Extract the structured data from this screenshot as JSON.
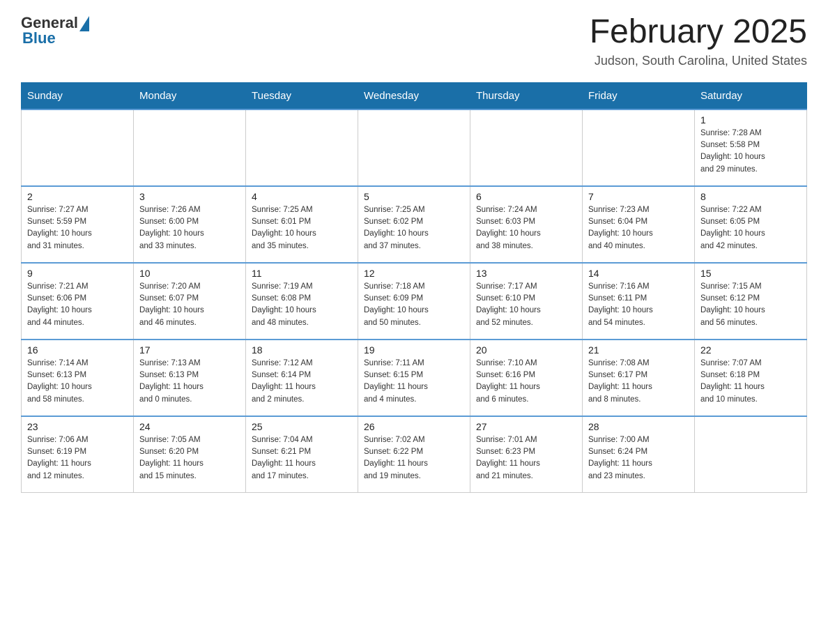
{
  "header": {
    "logo_general": "General",
    "logo_blue": "Blue",
    "title": "February 2025",
    "location": "Judson, South Carolina, United States"
  },
  "days_of_week": [
    "Sunday",
    "Monday",
    "Tuesday",
    "Wednesday",
    "Thursday",
    "Friday",
    "Saturday"
  ],
  "weeks": [
    [
      {
        "day": "",
        "info": ""
      },
      {
        "day": "",
        "info": ""
      },
      {
        "day": "",
        "info": ""
      },
      {
        "day": "",
        "info": ""
      },
      {
        "day": "",
        "info": ""
      },
      {
        "day": "",
        "info": ""
      },
      {
        "day": "1",
        "info": "Sunrise: 7:28 AM\nSunset: 5:58 PM\nDaylight: 10 hours\nand 29 minutes."
      }
    ],
    [
      {
        "day": "2",
        "info": "Sunrise: 7:27 AM\nSunset: 5:59 PM\nDaylight: 10 hours\nand 31 minutes."
      },
      {
        "day": "3",
        "info": "Sunrise: 7:26 AM\nSunset: 6:00 PM\nDaylight: 10 hours\nand 33 minutes."
      },
      {
        "day": "4",
        "info": "Sunrise: 7:25 AM\nSunset: 6:01 PM\nDaylight: 10 hours\nand 35 minutes."
      },
      {
        "day": "5",
        "info": "Sunrise: 7:25 AM\nSunset: 6:02 PM\nDaylight: 10 hours\nand 37 minutes."
      },
      {
        "day": "6",
        "info": "Sunrise: 7:24 AM\nSunset: 6:03 PM\nDaylight: 10 hours\nand 38 minutes."
      },
      {
        "day": "7",
        "info": "Sunrise: 7:23 AM\nSunset: 6:04 PM\nDaylight: 10 hours\nand 40 minutes."
      },
      {
        "day": "8",
        "info": "Sunrise: 7:22 AM\nSunset: 6:05 PM\nDaylight: 10 hours\nand 42 minutes."
      }
    ],
    [
      {
        "day": "9",
        "info": "Sunrise: 7:21 AM\nSunset: 6:06 PM\nDaylight: 10 hours\nand 44 minutes."
      },
      {
        "day": "10",
        "info": "Sunrise: 7:20 AM\nSunset: 6:07 PM\nDaylight: 10 hours\nand 46 minutes."
      },
      {
        "day": "11",
        "info": "Sunrise: 7:19 AM\nSunset: 6:08 PM\nDaylight: 10 hours\nand 48 minutes."
      },
      {
        "day": "12",
        "info": "Sunrise: 7:18 AM\nSunset: 6:09 PM\nDaylight: 10 hours\nand 50 minutes."
      },
      {
        "day": "13",
        "info": "Sunrise: 7:17 AM\nSunset: 6:10 PM\nDaylight: 10 hours\nand 52 minutes."
      },
      {
        "day": "14",
        "info": "Sunrise: 7:16 AM\nSunset: 6:11 PM\nDaylight: 10 hours\nand 54 minutes."
      },
      {
        "day": "15",
        "info": "Sunrise: 7:15 AM\nSunset: 6:12 PM\nDaylight: 10 hours\nand 56 minutes."
      }
    ],
    [
      {
        "day": "16",
        "info": "Sunrise: 7:14 AM\nSunset: 6:13 PM\nDaylight: 10 hours\nand 58 minutes."
      },
      {
        "day": "17",
        "info": "Sunrise: 7:13 AM\nSunset: 6:13 PM\nDaylight: 11 hours\nand 0 minutes."
      },
      {
        "day": "18",
        "info": "Sunrise: 7:12 AM\nSunset: 6:14 PM\nDaylight: 11 hours\nand 2 minutes."
      },
      {
        "day": "19",
        "info": "Sunrise: 7:11 AM\nSunset: 6:15 PM\nDaylight: 11 hours\nand 4 minutes."
      },
      {
        "day": "20",
        "info": "Sunrise: 7:10 AM\nSunset: 6:16 PM\nDaylight: 11 hours\nand 6 minutes."
      },
      {
        "day": "21",
        "info": "Sunrise: 7:08 AM\nSunset: 6:17 PM\nDaylight: 11 hours\nand 8 minutes."
      },
      {
        "day": "22",
        "info": "Sunrise: 7:07 AM\nSunset: 6:18 PM\nDaylight: 11 hours\nand 10 minutes."
      }
    ],
    [
      {
        "day": "23",
        "info": "Sunrise: 7:06 AM\nSunset: 6:19 PM\nDaylight: 11 hours\nand 12 minutes."
      },
      {
        "day": "24",
        "info": "Sunrise: 7:05 AM\nSunset: 6:20 PM\nDaylight: 11 hours\nand 15 minutes."
      },
      {
        "day": "25",
        "info": "Sunrise: 7:04 AM\nSunset: 6:21 PM\nDaylight: 11 hours\nand 17 minutes."
      },
      {
        "day": "26",
        "info": "Sunrise: 7:02 AM\nSunset: 6:22 PM\nDaylight: 11 hours\nand 19 minutes."
      },
      {
        "day": "27",
        "info": "Sunrise: 7:01 AM\nSunset: 6:23 PM\nDaylight: 11 hours\nand 21 minutes."
      },
      {
        "day": "28",
        "info": "Sunrise: 7:00 AM\nSunset: 6:24 PM\nDaylight: 11 hours\nand 23 minutes."
      },
      {
        "day": "",
        "info": ""
      }
    ]
  ]
}
